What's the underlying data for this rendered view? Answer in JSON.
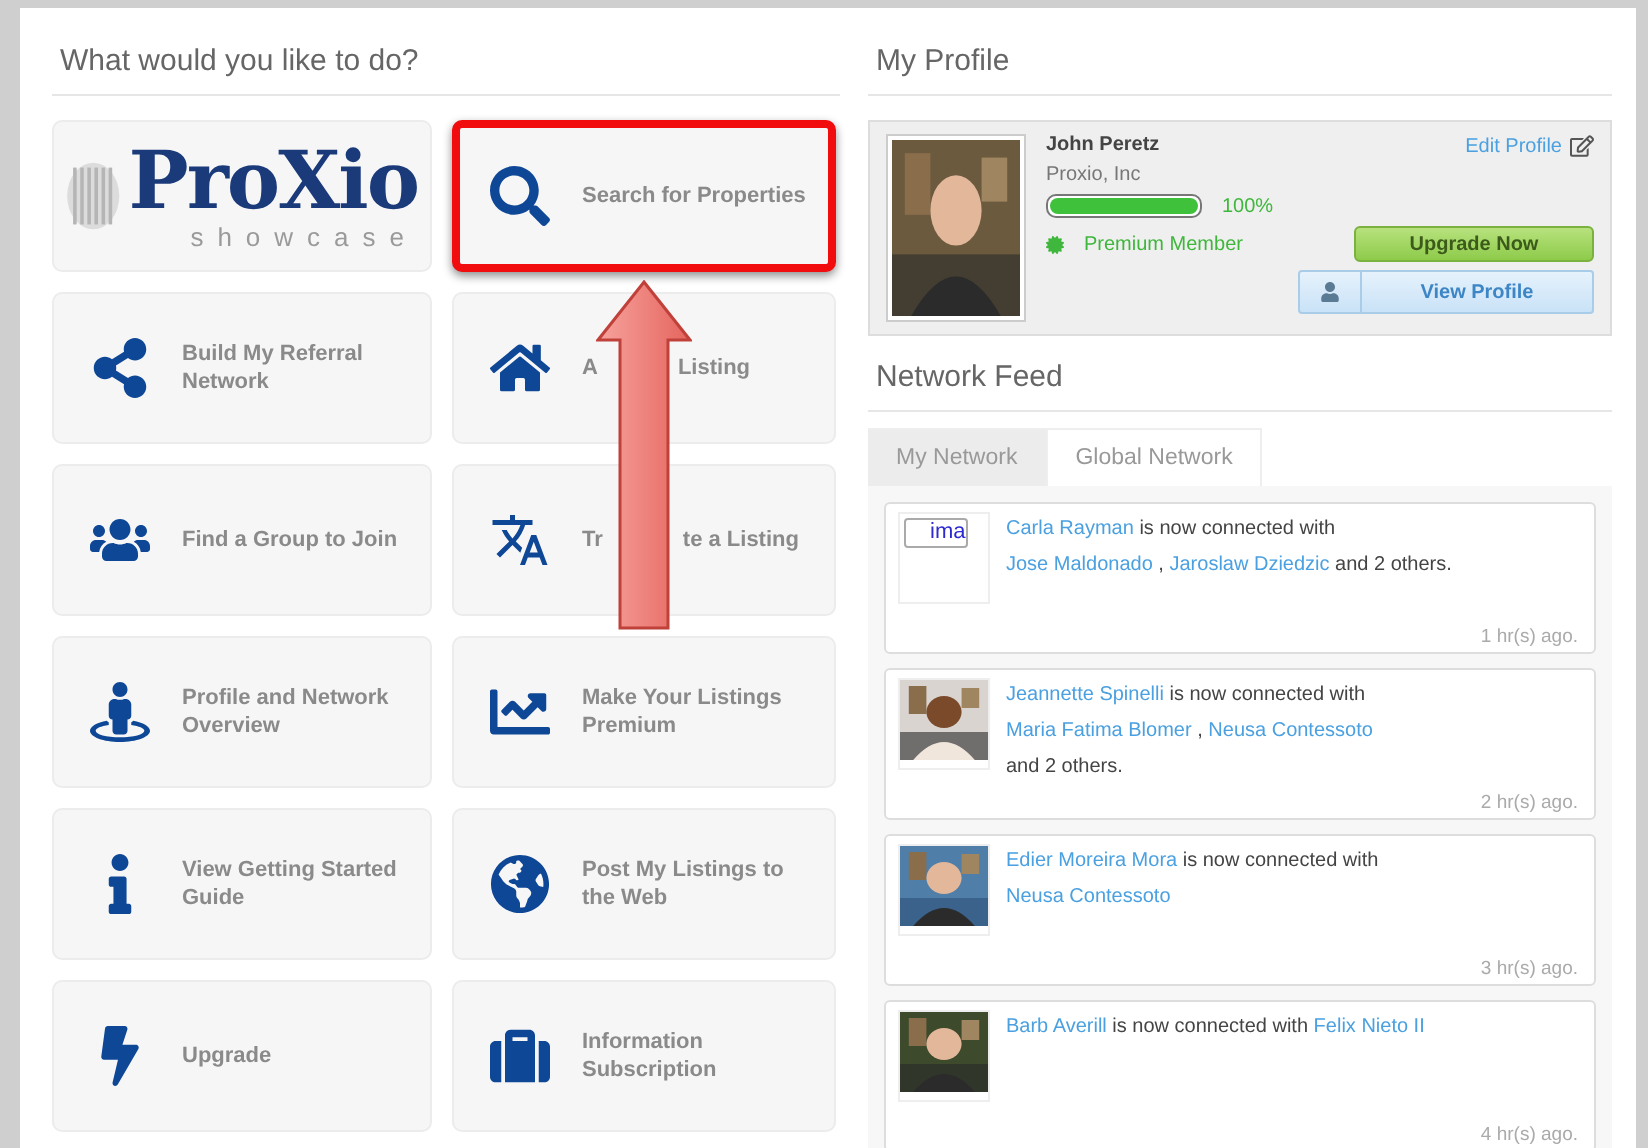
{
  "left": {
    "heading": "What would you like to do?",
    "logo": {
      "name": "ProXio",
      "tagline": "showcase"
    },
    "tiles": [
      {
        "kind": "logo"
      },
      {
        "kind": "share",
        "label_parts": [
          "Build My Referral Network"
        ],
        "annotated": false
      },
      {
        "kind": "group",
        "label_parts": [
          "Find a Group to Join"
        ],
        "annotated": false
      },
      {
        "kind": "person",
        "label_parts": [
          "Profile and Network Overview"
        ],
        "annotated": false
      },
      {
        "kind": "info",
        "label_parts": [
          "View Getting Started Guide"
        ],
        "annotated": false
      },
      {
        "kind": "bolt",
        "label_parts": [
          "Upgrade"
        ],
        "annotated": false
      },
      {
        "kind": "search",
        "label_parts": [
          "Search for Properties"
        ],
        "annotated": true
      },
      {
        "kind": "home",
        "label_parts": [
          "A",
          "Listing"
        ],
        "annotated": false
      },
      {
        "kind": "translate",
        "label_parts": [
          "Tr",
          "te a Listing"
        ],
        "annotated": false
      },
      {
        "kind": "chart",
        "label_parts": [
          "Make Your Listings Premium"
        ],
        "annotated": false
      },
      {
        "kind": "globe",
        "label_parts": [
          "Post My Listings to the Web"
        ],
        "annotated": false
      },
      {
        "kind": "briefcase",
        "label_parts": [
          "Information Subscription"
        ],
        "annotated": false
      }
    ],
    "annotation_arrow": {
      "color": "#e5655e"
    }
  },
  "profile": {
    "heading": "My Profile",
    "name": "John Peretz",
    "company": "Proxio, Inc",
    "level": 1,
    "percent": "100%",
    "membership": "Premium Member",
    "edit_link": "Edit Profile",
    "upgrade_button": "Upgrade Now",
    "view_button": "View Profile"
  },
  "feed": {
    "heading": "Network Feed",
    "tabs": [
      {
        "label": "My Network",
        "selected": true
      },
      {
        "label": "Global Network",
        "selected": false
      }
    ],
    "items": [
      {
        "avatar": {
          "kind": "broken",
          "alt": "ima"
        },
        "lines": [
          [
            {
              "kind": "link",
              "text": "Carla Rayman"
            },
            {
              "kind": "text",
              "text": " is now connected with"
            }
          ],
          [
            {
              "kind": "link",
              "text": "Jose Maldonado"
            },
            {
              "kind": "text",
              "text": " , "
            },
            {
              "kind": "link",
              "text": "Jaroslaw Dziedzic"
            },
            {
              "kind": "text",
              "text": " and 2 others."
            }
          ]
        ],
        "time": "1 hr(s) ago."
      },
      {
        "avatar": {
          "kind": "picture"
        },
        "lines": [
          [
            {
              "kind": "link",
              "text": "Jeannette Spinelli"
            },
            {
              "kind": "text",
              "text": " is now connected with"
            }
          ],
          [
            {
              "kind": "link",
              "text": "Maria Fatima Blomer"
            },
            {
              "kind": "text",
              "text": " , "
            },
            {
              "kind": "link",
              "text": "Neusa Contessoto"
            }
          ],
          [
            {
              "kind": "text",
              "text": "and 2 others."
            }
          ]
        ],
        "time": "2 hr(s) ago."
      },
      {
        "avatar": {
          "kind": "picture"
        },
        "lines": [
          [
            {
              "kind": "link",
              "text": "Edier Moreira Mora"
            },
            {
              "kind": "text",
              "text": " is now connected with"
            }
          ],
          [
            {
              "kind": "link",
              "text": "Neusa Contessoto"
            }
          ]
        ],
        "time": "3 hr(s) ago."
      },
      {
        "avatar": {
          "kind": "picture"
        },
        "lines": [
          [
            {
              "kind": "link",
              "text": "Barb Averill"
            },
            {
              "kind": "text",
              "text": " is now connected with "
            },
            {
              "kind": "link",
              "text": "Felix Nieto II"
            }
          ]
        ],
        "time": "4 hr(s) ago."
      }
    ]
  }
}
